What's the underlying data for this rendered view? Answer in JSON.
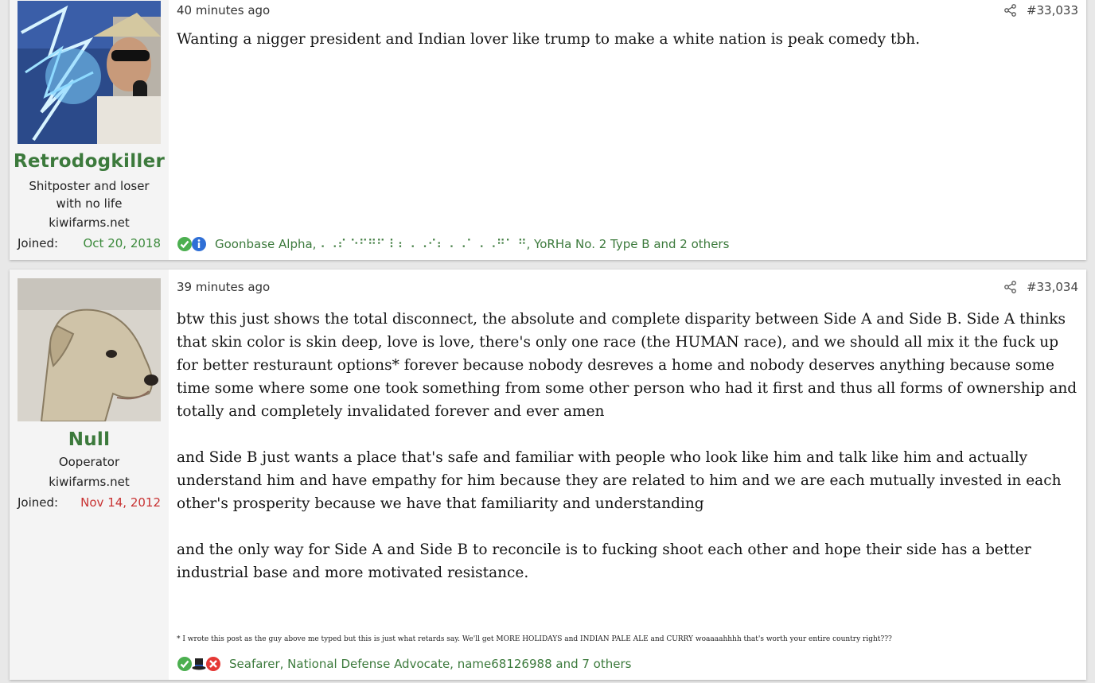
{
  "posts": [
    {
      "user": {
        "name": "Retrodogkiller",
        "title": "Shitposter and loser with no life",
        "site": "kiwifarms.net",
        "joined_label": "Joined:",
        "joined_date": "Oct 20, 2018"
      },
      "time": "40 minutes ago",
      "number": "#33,033",
      "body": [
        "Wanting a nigger president and Indian lover like trump to make a white nation is peak comedy tbh."
      ],
      "reactions": {
        "icons": [
          "check-icon",
          "info-icon"
        ],
        "users": "Goonbase Alpha, ⠄⠠⠎ ⠑⠋⠛⠋ ⠇⠆ ⠄⠠⠊⠆ ⠄⠠⠁ ⠄⠠⠛⠁ ⠛, YoRHa No. 2 Type B and 2 others"
      }
    },
    {
      "user": {
        "name": "Null",
        "title": "Ooperator",
        "site": "kiwifarms.net",
        "joined_label": "Joined:",
        "joined_date": "Nov 14, 2012"
      },
      "time": "39 minutes ago",
      "number": "#33,034",
      "body": [
        "btw this just shows the total disconnect, the absolute and complete disparity between Side A and Side B. Side A thinks that skin color is skin deep, love is love, there's only one race (the HUMAN race), and we should all mix it the fuck up for better resturaunt options* forever because nobody desreves a home and nobody deserves anything because some time some where some one took something from some other person who had it first and thus all forms of ownership and totally and completely invalidated forever and ever amen",
        "and Side B just wants a place that's safe and familiar with people who look like him and talk like him and actually understand him and have empathy for him because they are related to him and we are each mutually invested in each other's prosperity because we have that familiarity and understanding",
        "and the only way for Side A and Side B to reconcile is to fucking shoot each other and hope their side has a better industrial base and more motivated resistance."
      ],
      "footnote": "* I wrote this post as the guy above me typed but this is just what retards say. We'll get MORE HOLIDAYS and INDIAN PALE ALE and CURRY woaaaahhhh that's worth your entire country right???",
      "reactions": {
        "icons": [
          "check-icon",
          "top-hat-icon",
          "cross-icon"
        ],
        "users": "Seafarer, National Defense Advocate, name68126988 and 7 others"
      }
    }
  ],
  "colors": {
    "username": "#3c7a3c",
    "joined_green": "#3c8a3c",
    "joined_red": "#c83232",
    "reaction_users": "#3c7a3c"
  }
}
